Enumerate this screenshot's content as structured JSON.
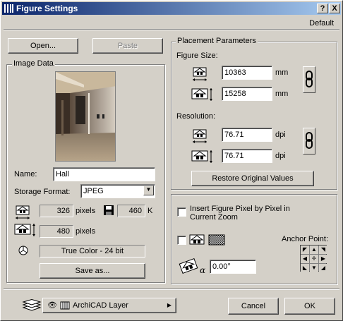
{
  "window": {
    "title": "Figure Settings",
    "help_label": "?",
    "close_label": "X",
    "default_label": "Default"
  },
  "buttons": {
    "open": "Open...",
    "paste": "Paste",
    "save_as": "Save as...",
    "restore": "Restore Original Values",
    "cancel": "Cancel",
    "ok": "OK"
  },
  "image_data": {
    "group_label": "Image Data",
    "name_label": "Name:",
    "name_value": "Hall",
    "storage_label": "Storage Format:",
    "storage_value": "JPEG",
    "width_value": "326",
    "width_unit": "pixels",
    "file_size_value": "460",
    "file_size_unit": "K",
    "height_value": "480",
    "height_unit": "pixels",
    "color_depth": "True Color - 24 bit"
  },
  "placement": {
    "group_label": "Placement Parameters",
    "figure_size_label": "Figure Size:",
    "width_value": "10363",
    "height_value": "15258",
    "size_unit": "mm",
    "resolution_label": "Resolution:",
    "res_h_value": "76.71",
    "res_v_value": "76.71",
    "res_unit": "dpi"
  },
  "options": {
    "insert_pixel_label": "Insert Figure Pixel by Pixel in Current Zoom",
    "anchor_label": "Anchor Point:",
    "angle_value": "0.00°"
  },
  "footer": {
    "layer_value": "ArchiCAD Layer"
  }
}
